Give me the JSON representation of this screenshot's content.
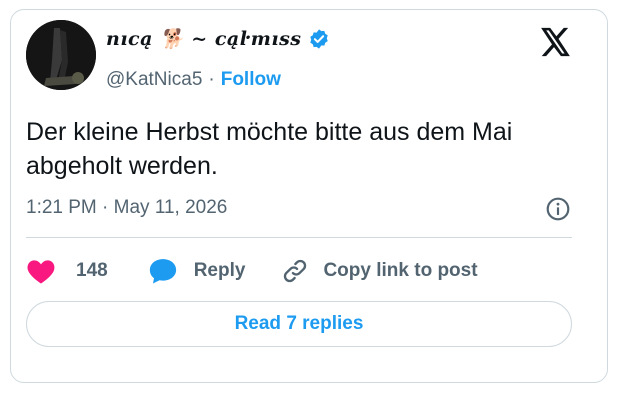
{
  "author": {
    "display_name": "nıcą 🐕 ~ cąŀmıss",
    "handle": "@KatNica5",
    "separator": "·",
    "follow_label": "Follow"
  },
  "tweet": {
    "text": "Der kleine Herbst möchte bitte aus dem Mai abgeholt werden.",
    "timestamp": "1:21 PM · May 11, 2026"
  },
  "actions": {
    "like_count": "148",
    "reply_label": "Reply",
    "copy_label": "Copy link to post"
  },
  "read_replies_label": "Read 7 replies",
  "colors": {
    "accent": "#1d9bf0",
    "like": "#f91880",
    "text": "#0f1419",
    "muted": "#536471",
    "border": "#cfd9de"
  },
  "icons": [
    "verified-badge-icon",
    "x-logo-icon",
    "info-icon",
    "heart-icon",
    "reply-bubble-icon",
    "link-icon"
  ]
}
